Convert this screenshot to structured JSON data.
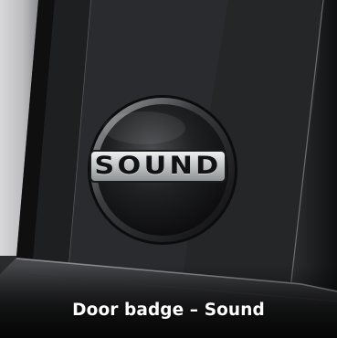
{
  "product_card": {
    "caption": "Door badge – Sound",
    "badge_text": "SOUND"
  },
  "icons": {
    "photo": "door-badge-photo",
    "badge": "sound-badge-emblem"
  },
  "colors": {
    "caption_text": "#ffffff",
    "badge_disc": "#161719",
    "badge_plate": "#c9cccd"
  }
}
